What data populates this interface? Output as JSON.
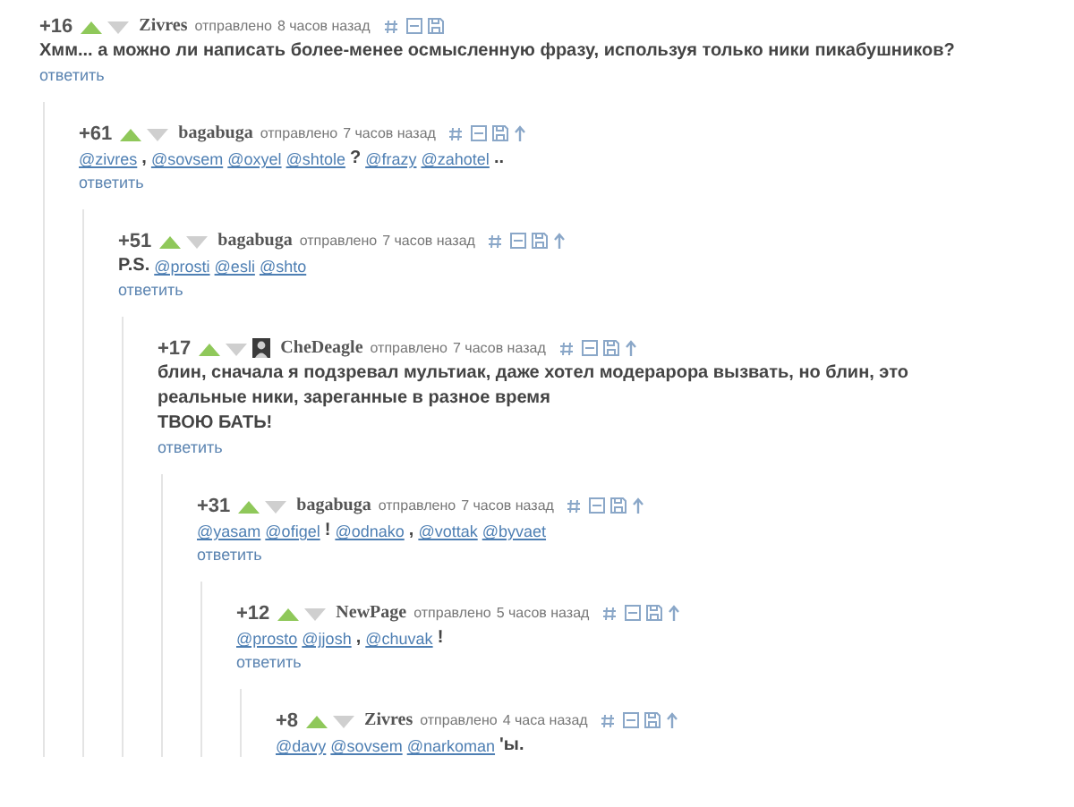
{
  "comments": [
    {
      "rating": "+16",
      "author": "Zivres",
      "avatar": false,
      "sent_label": "отправлено",
      "time": "8 часов назад",
      "parent_link": false,
      "body": [
        [
          {
            "kind": "text",
            "text": "Хмм... а можно ли написать более-менее осмысленную фразу, используя только ники пикабушников?"
          }
        ]
      ],
      "reply": "ответить",
      "children": [
        {
          "rating": "+61",
          "author": "bagabuga",
          "avatar": false,
          "sent_label": "отправлено",
          "time": "7 часов назад",
          "parent_link": true,
          "body": [
            [
              {
                "kind": "mention",
                "text": "@zivres"
              },
              {
                "kind": "text",
                "text": ","
              },
              {
                "kind": "mention",
                "text": "@sovsem"
              },
              {
                "kind": "mention",
                "text": "@oxyel"
              },
              {
                "kind": "mention",
                "text": "@shtole"
              },
              {
                "kind": "text",
                "text": "?"
              },
              {
                "kind": "mention",
                "text": "@frazy"
              },
              {
                "kind": "mention",
                "text": "@zahotel"
              },
              {
                "kind": "text",
                "text": ".."
              }
            ]
          ],
          "reply": "ответить",
          "children": [
            {
              "rating": "+51",
              "author": "bagabuga",
              "avatar": false,
              "sent_label": "отправлено",
              "time": "7 часов назад",
              "parent_link": true,
              "body": [
                [
                  {
                    "kind": "text",
                    "text": "P.S."
                  },
                  {
                    "kind": "mention",
                    "text": "@prosti"
                  },
                  {
                    "kind": "mention",
                    "text": "@esli"
                  },
                  {
                    "kind": "mention",
                    "text": "@shto"
                  }
                ]
              ],
              "reply": "ответить",
              "children": [
                {
                  "rating": "+17",
                  "author": "CheDeagle",
                  "avatar": true,
                  "sent_label": "отправлено",
                  "time": "7 часов назад",
                  "parent_link": true,
                  "body": [
                    [
                      {
                        "kind": "text",
                        "text": "блин, сначала я подзревал мультиак, даже хотел модерарора вызвать, но блин, это"
                      }
                    ],
                    [
                      {
                        "kind": "text",
                        "text": "реальные ники, зареганные в разное время"
                      }
                    ],
                    [
                      {
                        "kind": "text",
                        "text": "ТВОЮ БАТЬ!"
                      }
                    ]
                  ],
                  "reply": "ответить",
                  "children": [
                    {
                      "rating": "+31",
                      "author": "bagabuga",
                      "avatar": false,
                      "sent_label": "отправлено",
                      "time": "7 часов назад",
                      "parent_link": true,
                      "body": [
                        [
                          {
                            "kind": "mention",
                            "text": "@yasam"
                          },
                          {
                            "kind": "mention",
                            "text": "@ofigel"
                          },
                          {
                            "kind": "text",
                            "text": "!"
                          },
                          {
                            "kind": "mention",
                            "text": "@odnako"
                          },
                          {
                            "kind": "text",
                            "text": ","
                          },
                          {
                            "kind": "mention",
                            "text": "@vottak"
                          },
                          {
                            "kind": "mention",
                            "text": "@byvaet"
                          }
                        ]
                      ],
                      "reply": "ответить",
                      "children": [
                        {
                          "rating": "+12",
                          "author": "NewPage",
                          "avatar": false,
                          "sent_label": "отправлено",
                          "time": "5 часов назад",
                          "parent_link": true,
                          "body": [
                            [
                              {
                                "kind": "mention",
                                "text": "@prosto"
                              },
                              {
                                "kind": "mention",
                                "text": "@jjosh"
                              },
                              {
                                "kind": "text",
                                "text": ","
                              },
                              {
                                "kind": "mention",
                                "text": "@chuvak"
                              },
                              {
                                "kind": "text",
                                "text": "!"
                              }
                            ]
                          ],
                          "reply": "ответить",
                          "children": [
                            {
                              "rating": "+8",
                              "author": "Zivres",
                              "avatar": false,
                              "sent_label": "отправлено",
                              "time": "4 часа назад",
                              "parent_link": true,
                              "body": [
                                [
                                  {
                                    "kind": "mention",
                                    "text": "@davy"
                                  },
                                  {
                                    "kind": "mention",
                                    "text": "@sovsem"
                                  },
                                  {
                                    "kind": "mention",
                                    "text": "@narkoman"
                                  },
                                  {
                                    "kind": "text",
                                    "text": "'ы."
                                  }
                                ]
                              ]
                            }
                          ]
                        }
                      ]
                    }
                  ]
                }
              ]
            }
          ]
        }
      ]
    }
  ]
}
